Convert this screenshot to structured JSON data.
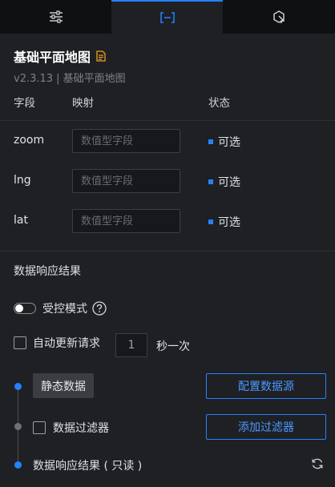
{
  "tabs": [
    {
      "icon": "sliders-icon",
      "active": false
    },
    {
      "icon": "bracket-field-icon",
      "active": true
    },
    {
      "icon": "interaction-cursor-icon",
      "active": false
    }
  ],
  "panel": {
    "title": "基础平面地图",
    "version": "v2.3.13 | 基础平面地图"
  },
  "table": {
    "headers": {
      "field": "字段",
      "mapping": "映射",
      "status": "状态"
    },
    "rows": [
      {
        "field": "zoom",
        "placeholder": "数值型字段",
        "status": "可选"
      },
      {
        "field": "lng",
        "placeholder": "数值型字段",
        "status": "可选"
      },
      {
        "field": "lat",
        "placeholder": "数值型字段",
        "status": "可选"
      }
    ]
  },
  "response": {
    "section_title": "数据响应结果",
    "controlled_mode_label": "受控模式",
    "auto_update_label": "自动更新请求",
    "interval_value": "1",
    "interval_unit": "秒一次",
    "static_data_label": "静态数据",
    "config_source_label": "配置数据源",
    "filter_label": "数据过滤器",
    "add_filter_label": "添加过滤器",
    "result_label": "数据响应结果 ( 只读 )"
  },
  "colors": {
    "accent": "#2681ff",
    "background": "#1e2024",
    "tab_bar": "#0f1012"
  }
}
